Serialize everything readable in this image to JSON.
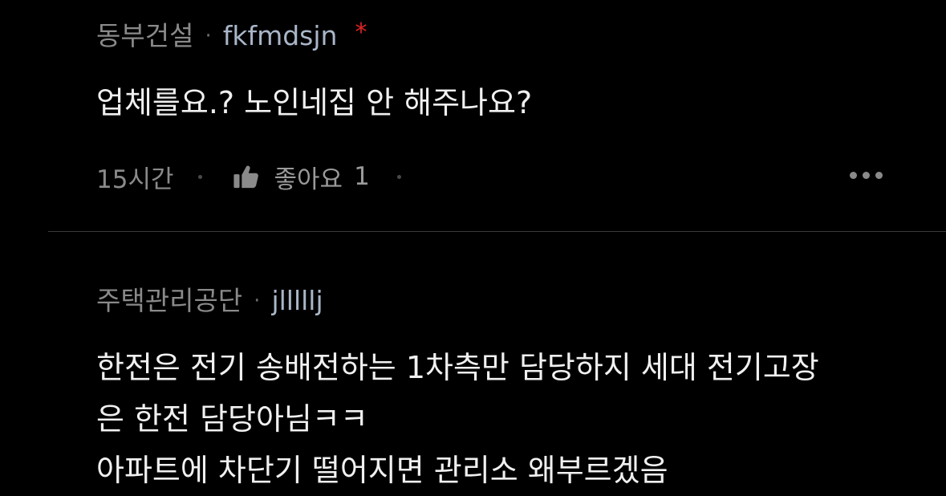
{
  "comments": [
    {
      "company": "동부건설",
      "separator": "·",
      "user": "fkfmdsjn",
      "marker": "*",
      "text_lines": [
        "업체를요.? 노인네집 안 해주나요?"
      ],
      "time": "15시간",
      "like_label": "좋아요",
      "like_count": "1"
    },
    {
      "company": "주택관리공단",
      "separator": "·",
      "user": "jlllllj",
      "text_lines": [
        "한전은 전기 송배전하는 1차측만 담당하지 세대 전기고장",
        "은 한전 담당아님ㅋㅋ",
        "아파트에 차단기 떨어지면 관리소 왜부르겠음"
      ]
    }
  ],
  "colors": {
    "background": "#000000",
    "meta_text": "#8a8a8a",
    "username": "#a9b6c8",
    "marker": "#e02424",
    "body_text": "#f0f0f0"
  },
  "icons": {
    "like": "thumbs-up-icon",
    "more": "more-options-icon"
  }
}
